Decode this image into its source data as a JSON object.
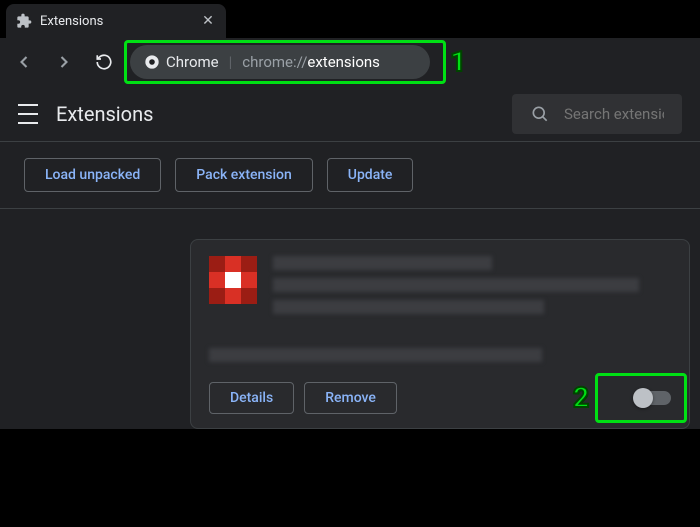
{
  "tab": {
    "title": "Extensions"
  },
  "address": {
    "chip_label": "Chrome",
    "url_prefix": "chrome://",
    "url_path": "extensions"
  },
  "header": {
    "title": "Extensions"
  },
  "search": {
    "placeholder": "Search extensions"
  },
  "actions": {
    "load_unpacked": "Load unpacked",
    "pack_extension": "Pack extension",
    "update": "Update"
  },
  "card": {
    "details_label": "Details",
    "remove_label": "Remove",
    "enabled": false
  },
  "annotations": {
    "addr_num": "1",
    "toggle_num": "2"
  }
}
